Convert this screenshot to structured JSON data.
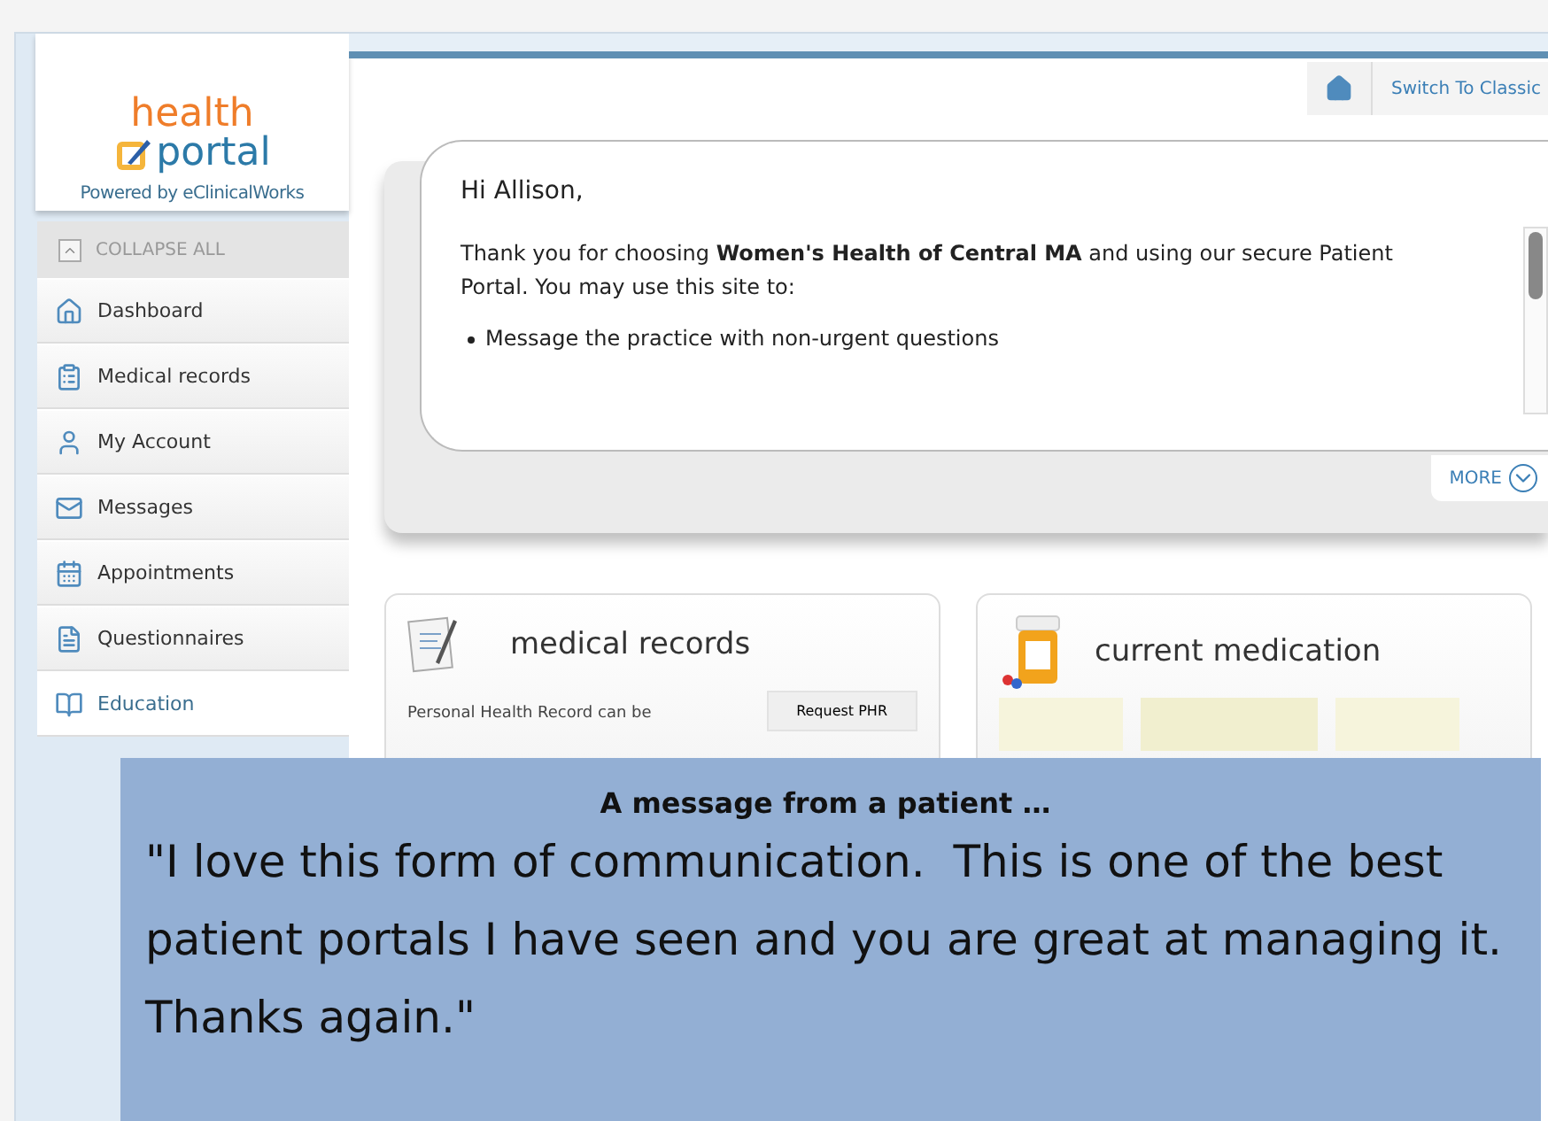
{
  "logo": {
    "word_1": "health",
    "word_2": "portal",
    "tagline": "Powered by eClinicalWorks"
  },
  "sidebar": {
    "collapse": "COLLAPSE ALL",
    "items": [
      {
        "label": "Dashboard",
        "selected": false
      },
      {
        "label": "Medical records",
        "selected": false
      },
      {
        "label": "My Account",
        "selected": false
      },
      {
        "label": "Messages",
        "selected": false
      },
      {
        "label": "Appointments",
        "selected": false
      },
      {
        "label": "Questionnaires",
        "selected": false
      },
      {
        "label": "Education",
        "selected": true
      }
    ]
  },
  "toolbar": {
    "switch_view": "Switch To Classic"
  },
  "welcome": {
    "greeting": "Hi Allison,",
    "message": "Thank you for choosing **Women's Health of Central MA** and using our secure Patient Portal. You may use this site to:",
    "bullets": [
      "Message the practice with non-urgent questions"
    ],
    "more": "MORE"
  },
  "cards": [
    {
      "kind": "records",
      "title": "medical records",
      "text": "Personal Health Record can be",
      "button": "Request PHR"
    },
    {
      "kind": "medication",
      "title": "current medication"
    }
  ],
  "testimonial": {
    "heading": "A message from a patient …",
    "quote": "\"I love this form of communication.  This is one of the best patient portals I have seen and you are great at managing it.  Thanks again.\""
  }
}
